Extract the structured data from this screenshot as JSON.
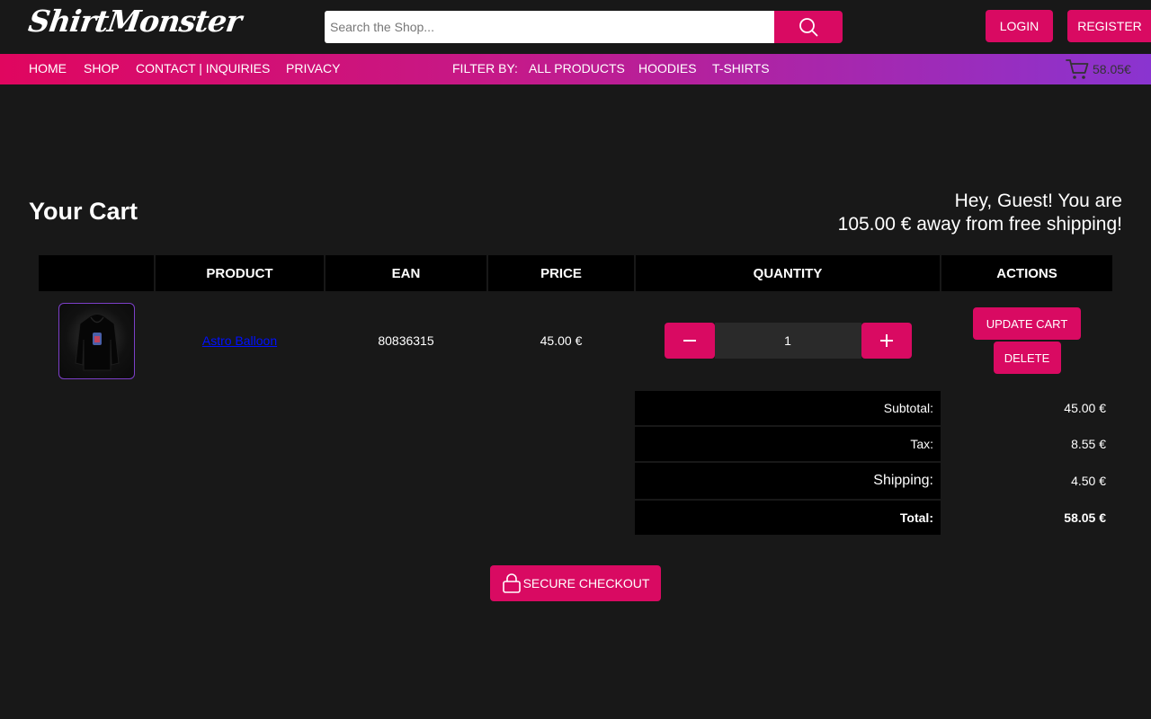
{
  "header": {
    "logo_text": "ShirtMonster",
    "search_placeholder": "Search the Shop...",
    "login_label": "LOGIN",
    "register_label": "REGISTER"
  },
  "nav": {
    "links": [
      "HOME",
      "SHOP",
      "CONTACT | INQUIRIES",
      "PRIVACY"
    ],
    "filter_label": "FILTER BY:",
    "filters": [
      "ALL PRODUCTS",
      "HOODIES",
      "T-SHIRTS"
    ],
    "cart_total": "58.05€"
  },
  "cart": {
    "title": "Your Cart",
    "shipping_line1": "Hey, Guest! You are",
    "shipping_line2": "105.00 € away from free shipping!",
    "columns": [
      "",
      "PRODUCT",
      "EAN",
      "PRICE",
      "QUANTITY",
      "ACTIONS"
    ],
    "items": [
      {
        "product": "Astro Balloon",
        "ean": "80836315",
        "price": "45.00 €",
        "quantity": "1"
      }
    ],
    "update_label": "UPDATE CART",
    "delete_label": "DELETE"
  },
  "totals": {
    "subtotal_label": "Subtotal:",
    "subtotal": "45.00 €",
    "tax_label": "Tax:",
    "tax": "8.55 €",
    "shipping_label": "Shipping:",
    "shipping": "4.50 €",
    "total_label": "Total:",
    "total": "58.05 €"
  },
  "checkout_label": "SECURE CHECKOUT",
  "colors": {
    "accent": "#d90a62",
    "nav_gradient_end": "#8a34d0",
    "background": "#181818"
  },
  "icons": {
    "search": "search-icon",
    "cart": "cart-icon",
    "minus": "minus-icon",
    "plus": "plus-icon",
    "lock": "lock-icon"
  }
}
